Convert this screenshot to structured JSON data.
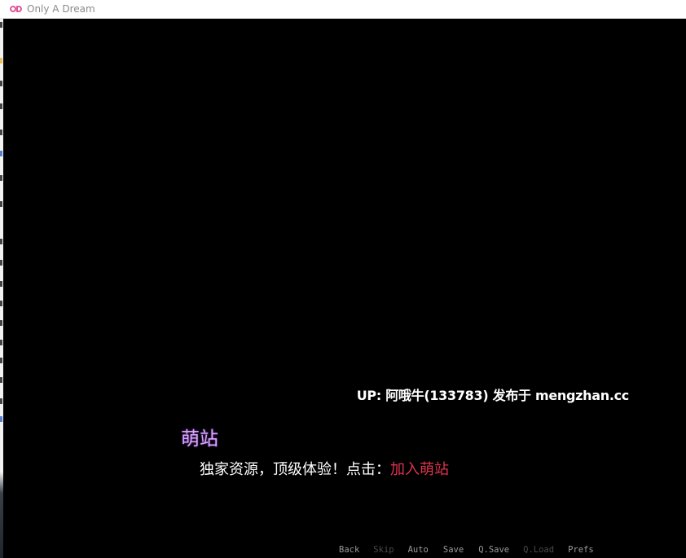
{
  "window": {
    "title": "Only A Dream",
    "icon": "od-logo-icon",
    "icon_color": "#e0448f"
  },
  "game": {
    "up_notice": "UP: 阿哦牛(133783) 发布于 mengzhan.cc",
    "speaker": "萌站",
    "speaker_color": "#d9a6ff",
    "dialogue_text": "独家资源，顶级体验！点击：",
    "dialogue_link": "加入萌站",
    "link_color": "#e0334f"
  },
  "quick_menu": {
    "items": [
      {
        "label": "Back",
        "enabled": true
      },
      {
        "label": "Skip",
        "enabled": false
      },
      {
        "label": "Auto",
        "enabled": true
      },
      {
        "label": "Save",
        "enabled": true
      },
      {
        "label": "Q.Save",
        "enabled": true
      },
      {
        "label": "Q.Load",
        "enabled": false
      },
      {
        "label": "Prefs",
        "enabled": true
      }
    ]
  }
}
